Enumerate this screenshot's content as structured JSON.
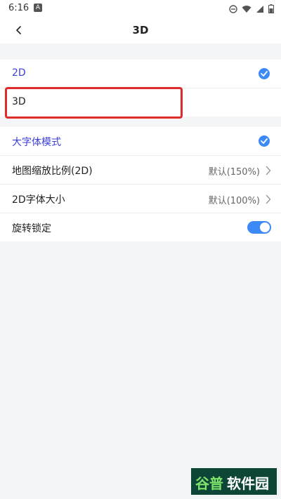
{
  "status_bar": {
    "time": "6:16",
    "notification_icon": "A"
  },
  "header": {
    "title": "3D"
  },
  "view_mode": {
    "items": [
      {
        "label": "2D",
        "selected": true
      },
      {
        "label": "3D",
        "selected": false
      }
    ]
  },
  "settings": {
    "large_font": {
      "label": "大字体模式",
      "checked": true
    },
    "map_scale": {
      "label": "地图缩放比例(2D)",
      "value": "默认(150%)"
    },
    "font_size_2d": {
      "label": "2D字体大小",
      "value": "默认(100%)"
    },
    "rotation_lock": {
      "label": "旋转锁定",
      "enabled": true
    }
  },
  "watermark": {
    "part1": "谷普",
    "part2": "软件园"
  },
  "colors": {
    "accent": "#3d8af7",
    "selected_text": "#3b3fd8",
    "highlight_box": "#e02b2b"
  }
}
